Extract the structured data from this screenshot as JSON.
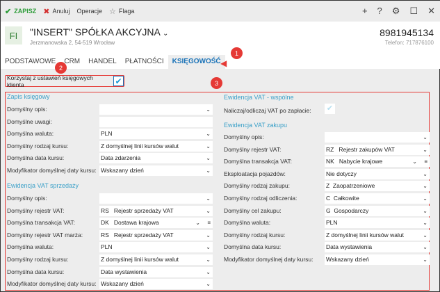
{
  "toolbar": {
    "save": "ZAPISZ",
    "cancel": "Anuluj",
    "operations": "Operacje",
    "flag": "Flaga"
  },
  "header": {
    "logo": "FI",
    "company": "\"INSERT\" SPÓŁKA AKCYJNA",
    "address": "Jerzmanowska 2, 54-519 Wrocław",
    "nip": "8981945134",
    "phone": "Telefon: 717876100"
  },
  "tabs": [
    "PODSTAWOWE",
    "CRM",
    "HANDEL",
    "PŁATNOŚCI",
    "KSIĘGOWOŚĆ"
  ],
  "active_tab": "KSIĘGOWOŚĆ",
  "annotations": [
    "1",
    "2",
    "3"
  ],
  "use_client_settings": {
    "label": "Korzystaj z ustawień księgowych klienta",
    "checked": true
  },
  "left": {
    "zapis": {
      "title": "Zapis księgowy",
      "rows": [
        {
          "label": "Domyślny opis:",
          "value": "",
          "dropdown": true
        },
        {
          "label": "Domyślne uwagi:",
          "value": "",
          "dropdown": false
        },
        {
          "label": "Domyślna waluta:",
          "value": "PLN",
          "dropdown": true
        },
        {
          "label": "Domyślny rodzaj kursu:",
          "value": "Z domyślnej linii kursów walut",
          "dropdown": true
        },
        {
          "label": "Domyślna data kursu:",
          "value": "Data zdarzenia",
          "dropdown": true
        },
        {
          "label": "Modyfikator domyślnej daty kursu:",
          "value": "Wskazany dzień",
          "dropdown": true
        }
      ]
    },
    "sprzedaz": {
      "title": "Ewidencja VAT sprzedaży",
      "rows": [
        {
          "label": "Domyślny opis:",
          "value": "",
          "dropdown": true
        },
        {
          "label": "Domyślny rejestr VAT:",
          "value": "RS   Rejestr sprzedaży VAT",
          "dropdown": true
        },
        {
          "label": "Domyślna transakcja VAT:",
          "value": "DK   Dostawa krajowa",
          "dropdown": true,
          "menu": true
        },
        {
          "label": "Domyślny rejestr VAT marża:",
          "value": "RS   Rejestr sprzedaży VAT",
          "dropdown": true
        },
        {
          "label": "Domyślna waluta:",
          "value": "PLN",
          "dropdown": true
        },
        {
          "label": "Domyślny rodzaj kursu:",
          "value": "Z domyślnej linii kursów walut",
          "dropdown": true
        },
        {
          "label": "Domyślna data kursu:",
          "value": "Data wystawienia",
          "dropdown": true
        },
        {
          "label": "Modyfikator domyślnej daty kursu:",
          "value": "Wskazany dzień",
          "dropdown": true
        }
      ]
    }
  },
  "right": {
    "wspolne": {
      "title": "Ewidencja VAT - wspólne",
      "vat_after_payment": {
        "label": "Naliczaj/odliczaj VAT po zapłacie:",
        "checked": true
      }
    },
    "zakup": {
      "title": "Ewidencja VAT zakupu",
      "rows": [
        {
          "label": "Domyślny opis:",
          "value": "",
          "dropdown": true
        },
        {
          "label": "Domyślny rejestr VAT:",
          "value": "RZ   Rejestr zakupów VAT",
          "dropdown": true
        },
        {
          "label": "Domyślna transakcja VAT:",
          "value": "NK   Nabycie krajowe",
          "dropdown": true,
          "menu": true
        },
        {
          "label": "Eksploatacja pojazdów:",
          "value": "Nie dotyczy",
          "dropdown": true
        },
        {
          "label": "Domyślny rodzaj zakupu:",
          "value": "Z  Zaopatrzeniowe",
          "dropdown": true
        },
        {
          "label": "Domyślny rodzaj odliczenia:",
          "value": "C  Całkowite",
          "dropdown": true
        },
        {
          "label": "Domyślny cel zakupu:",
          "value": "G  Gospodarczy",
          "dropdown": true
        },
        {
          "label": "Domyślna waluta:",
          "value": "PLN",
          "dropdown": true
        },
        {
          "label": "Domyślny rodzaj kursu:",
          "value": "Z domyślnej linii kursów walut",
          "dropdown": true
        },
        {
          "label": "Domyślna data kursu:",
          "value": "Data wystawienia",
          "dropdown": true
        },
        {
          "label": "Modyfikator domyślnej daty kursu:",
          "value": "Wskazany dzień",
          "dropdown": true
        }
      ]
    }
  },
  "colors": {
    "accent": "#1a73b8",
    "section": "#3aa0c8",
    "annotation": "#e53935",
    "save": "#2e9d3a"
  }
}
